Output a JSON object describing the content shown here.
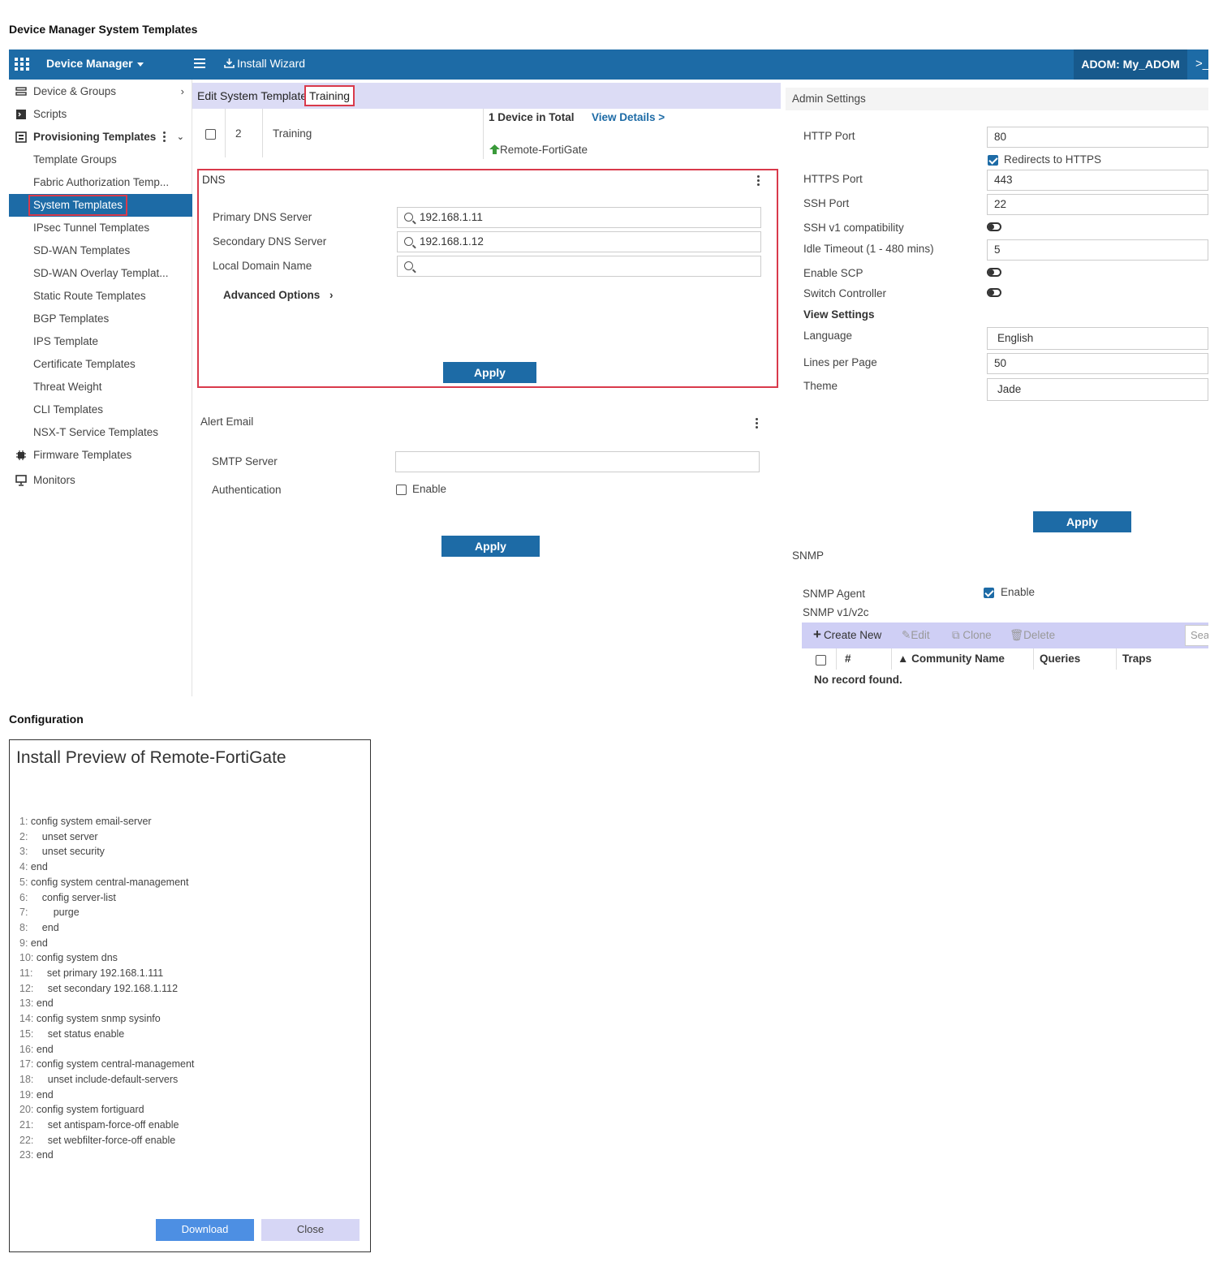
{
  "page_title": "Device Manager System Templates",
  "topbar": {
    "title": "Device Manager",
    "install_wizard": "Install Wizard",
    "adom": "ADOM: My_ADOM",
    "expand": ">_"
  },
  "sidebar": {
    "items": [
      {
        "label": "Device & Groups"
      },
      {
        "label": "Scripts"
      },
      {
        "label": "Provisioning Templates"
      },
      {
        "label": "Template Groups"
      },
      {
        "label": "Fabric Authorization Temp..."
      },
      {
        "label": "System Templates"
      },
      {
        "label": "IPsec Tunnel Templates"
      },
      {
        "label": "SD-WAN Templates"
      },
      {
        "label": "SD-WAN Overlay Templat..."
      },
      {
        "label": "Static Route Templates"
      },
      {
        "label": "BGP Templates"
      },
      {
        "label": "IPS Template"
      },
      {
        "label": "Certificate Templates"
      },
      {
        "label": "Threat Weight"
      },
      {
        "label": "CLI Templates"
      },
      {
        "label": "NSX-T Service Templates"
      },
      {
        "label": "Firmware Templates"
      },
      {
        "label": "Monitors"
      }
    ]
  },
  "edit_header": {
    "title": "Edit System Template",
    "name": "Training"
  },
  "device_row": {
    "count": "2",
    "name": "Training",
    "total": "1 Device in Total",
    "view_details": "View Details >",
    "device": "Remote-FortiGate"
  },
  "dns": {
    "title": "DNS",
    "primary_label": "Primary DNS Server",
    "primary_value": "192.168.1.11",
    "secondary_label": "Secondary DNS Server",
    "secondary_value": "192.168.1.12",
    "domain_label": "Local Domain Name",
    "domain_value": "",
    "advanced": "Advanced Options",
    "apply": "Apply"
  },
  "alert_email": {
    "title": "Alert Email",
    "smtp_label": "SMTP Server",
    "auth_label": "Authentication",
    "enable": "Enable",
    "apply": "Apply"
  },
  "admin": {
    "title": "Admin Settings",
    "http_port_label": "HTTP Port",
    "http_port": "80",
    "redirect": "Redirects to HTTPS",
    "https_port_label": "HTTPS Port",
    "https_port": "443",
    "ssh_port_label": "SSH Port",
    "ssh_port": "22",
    "ssh_v1_label": "SSH v1 compatibility",
    "idle_label": "Idle Timeout (1 - 480 mins)",
    "idle_value": "5",
    "scp_label": "Enable SCP",
    "switch_label": "Switch Controller",
    "view_settings": "View Settings",
    "language_label": "Language",
    "language": "English",
    "lines_label": "Lines per Page",
    "lines": "50",
    "theme_label": "Theme",
    "theme": "Jade",
    "apply": "Apply"
  },
  "snmp": {
    "title": "SNMP",
    "agent_label": "SNMP Agent",
    "enable": "Enable",
    "v1v2c": "SNMP v1/v2c",
    "create_new": "Create New",
    "edit": "Edit",
    "clone": "Clone",
    "delete": "Delete",
    "search": "Sea",
    "col_num": "#",
    "col_community": "▲ Community Name",
    "col_queries": "Queries",
    "col_traps": "Traps",
    "no_record": "No record found."
  },
  "configuration": {
    "heading": "Configuration",
    "title": "Install Preview of Remote-FortiGate",
    "lines": [
      {
        "n": "1:",
        "t": " config system email-server"
      },
      {
        "n": "2:",
        "t": "     unset server"
      },
      {
        "n": "3:",
        "t": "     unset security"
      },
      {
        "n": "4:",
        "t": " end"
      },
      {
        "n": "5:",
        "t": " config system central-management"
      },
      {
        "n": "6:",
        "t": "     config server-list"
      },
      {
        "n": "7:",
        "t": "         purge"
      },
      {
        "n": "8:",
        "t": "     end"
      },
      {
        "n": "9:",
        "t": " end"
      },
      {
        "n": "10:",
        "t": " config system dns"
      },
      {
        "n": "11:",
        "t": "     set primary 192.168.1.111"
      },
      {
        "n": "12:",
        "t": "     set secondary 192.168.1.112"
      },
      {
        "n": "13:",
        "t": " end"
      },
      {
        "n": "14:",
        "t": " config system snmp sysinfo"
      },
      {
        "n": "15:",
        "t": "     set status enable"
      },
      {
        "n": "16:",
        "t": " end"
      },
      {
        "n": "17:",
        "t": " config system central-management"
      },
      {
        "n": "18:",
        "t": "     unset include-default-servers"
      },
      {
        "n": "19:",
        "t": " end"
      },
      {
        "n": "20:",
        "t": " config system fortiguard"
      },
      {
        "n": "21:",
        "t": "     set antispam-force-off enable"
      },
      {
        "n": "22:",
        "t": "     set webfilter-force-off enable"
      },
      {
        "n": "23:",
        "t": " end"
      }
    ],
    "download": "Download",
    "close": "Close"
  }
}
